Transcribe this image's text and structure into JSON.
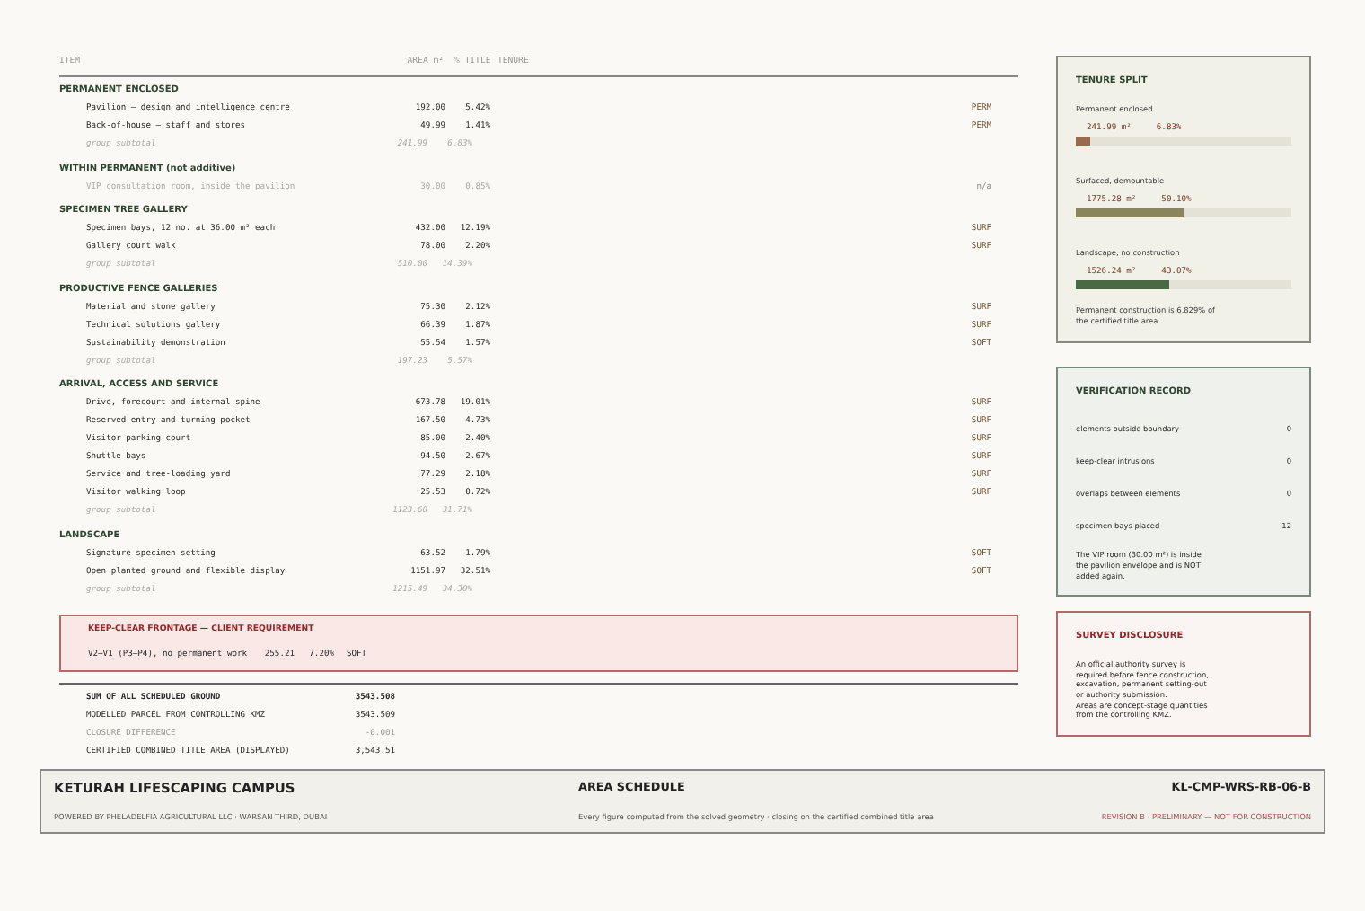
{
  "table": {
    "columns": [
      "ITEM",
      "AREA m²",
      "% TITLE",
      "TENURE"
    ],
    "groups": [
      {
        "title": "PERMANENT ENCLOSED",
        "kind": "additive",
        "items": [
          {
            "item": "Pavilion – design and intelligence centre",
            "area": "192.00",
            "pct": "5.42%",
            "tenure": "PERM"
          },
          {
            "item": "Back-of-house – staff and stores",
            "area": "49.99",
            "pct": "1.41%",
            "tenure": "PERM"
          }
        ],
        "subtotal": {
          "label": "group subtotal",
          "area": "241.99",
          "pct": "6.83%"
        }
      },
      {
        "title": "WITHIN PERMANENT (not additive)",
        "kind": "nonadditive",
        "items": [
          {
            "item": "VIP consultation room, inside the pavilion",
            "area": "30.00",
            "pct": "0.85%",
            "tenure": "n/a"
          }
        ]
      },
      {
        "title": "SPECIMEN TREE GALLERY",
        "kind": "additive",
        "items": [
          {
            "item": "Specimen bays, 12 no. at 36.00 m² each",
            "area": "432.00",
            "pct": "12.19%",
            "tenure": "SURF"
          },
          {
            "item": "Gallery court walk",
            "area": "78.00",
            "pct": "2.20%",
            "tenure": "SURF"
          }
        ],
        "subtotal": {
          "label": "group subtotal",
          "area": "510.00",
          "pct": "14.39%"
        }
      },
      {
        "title": "PRODUCTIVE FENCE GALLERIES",
        "kind": "additive",
        "items": [
          {
            "item": "Material and stone gallery",
            "area": "75.30",
            "pct": "2.12%",
            "tenure": "SURF"
          },
          {
            "item": "Technical solutions gallery",
            "area": "66.39",
            "pct": "1.87%",
            "tenure": "SURF"
          },
          {
            "item": "Sustainability demonstration",
            "area": "55.54",
            "pct": "1.57%",
            "tenure": "SOFT"
          }
        ],
        "subtotal": {
          "label": "group subtotal",
          "area": "197.23",
          "pct": "5.57%"
        }
      },
      {
        "title": "ARRIVAL, ACCESS AND SERVICE",
        "kind": "additive",
        "items": [
          {
            "item": "Drive, forecourt and internal spine",
            "area": "673.78",
            "pct": "19.01%",
            "tenure": "SURF"
          },
          {
            "item": "Reserved entry and turning pocket",
            "area": "167.50",
            "pct": "4.73%",
            "tenure": "SURF"
          },
          {
            "item": "Visitor parking court",
            "area": "85.00",
            "pct": "2.40%",
            "tenure": "SURF"
          },
          {
            "item": "Shuttle bays",
            "area": "94.50",
            "pct": "2.67%",
            "tenure": "SURF"
          },
          {
            "item": "Service and tree-loading yard",
            "area": "77.29",
            "pct": "2.18%",
            "tenure": "SURF"
          },
          {
            "item": "Visitor walking loop",
            "area": "25.53",
            "pct": "0.72%",
            "tenure": "SURF"
          }
        ],
        "subtotal": {
          "label": "group subtotal",
          "area": "1123.60",
          "pct": "31.71%"
        }
      },
      {
        "title": "LANDSCAPE",
        "kind": "additive",
        "items": [
          {
            "item": "Signature specimen setting",
            "area": "63.52",
            "pct": "1.79%",
            "tenure": "SOFT"
          },
          {
            "item": "Open planted ground and flexible display",
            "area": "1151.97",
            "pct": "32.51%",
            "tenure": "SOFT"
          }
        ],
        "subtotal": {
          "label": "group subtotal",
          "area": "1215.49",
          "pct": "34.30%"
        }
      }
    ]
  },
  "keep_clear": {
    "title": "KEEP-CLEAR FRONTAGE — CLIENT REQUIREMENT",
    "rows": [
      {
        "item": "V2–V1 (P3–P4), no permanent work",
        "area": "255.21",
        "pct": "7.20%",
        "tenure": "SOFT"
      }
    ]
  },
  "totals": [
    {
      "label": "SUM OF ALL SCHEDULED GROUND",
      "value": "3543.508",
      "kind": "bold"
    },
    {
      "label": "MODELLED PARCEL FROM CONTROLLING KMZ",
      "value": "3543.509",
      "kind": "plain"
    },
    {
      "label": "CLOSURE DIFFERENCE",
      "value": "-0.001",
      "kind": "muted"
    },
    {
      "label": "CERTIFIED COMBINED TITLE AREA (DISPLAYED)",
      "value": "3,543.51",
      "kind": "plain"
    }
  ],
  "sidebar": {
    "tenure_split": {
      "title": "TENURE SPLIT",
      "entries": [
        {
          "label": "Permanent enclosed",
          "area": "241.99 m²",
          "pct": "6.83%",
          "level": 0.0683,
          "color": "#9a6a50"
        },
        {
          "label": "Surfaced, demountable",
          "area": "1775.28 m²",
          "pct": "50.10%",
          "level": 0.501,
          "color": "#8a855a"
        },
        {
          "label": "Landscape, no construction",
          "area": "1526.24 m²",
          "pct": "43.07%",
          "level": 0.4307,
          "color": "#4a6a45"
        }
      ],
      "note": "Permanent construction is 6.829% of the certified title area."
    },
    "verification": {
      "title": "VERIFICATION RECORD",
      "checks": [
        {
          "label": "elements outside boundary",
          "value": "0"
        },
        {
          "label": "keep-clear intrusions",
          "value": "0"
        },
        {
          "label": "overlaps between elements",
          "value": "0"
        },
        {
          "label": "specimen bays placed",
          "value": "12"
        }
      ],
      "note": "The VIP room (30.00 m²) is inside the pavilion envelope and is NOT added again."
    },
    "disclosure": {
      "title": "SURVEY DISCLOSURE",
      "text": "An official authority survey is required before fence construction, excavation, permanent setting-out or authority submission.\nAreas are concept-stage quantities from the controlling KMZ."
    }
  },
  "footer": {
    "project": "KETURAH LIFESCAPING CAMPUS",
    "credit": "POWERED BY PHELADELFIA AGRICULTURAL LLC · WARSAN THIRD, DUBAI",
    "sheet_title": "AREA SCHEDULE",
    "sheet_note": "Every figure computed from the solved geometry · closing on the certified combined title area",
    "code": "KL-CMP-WRS-RB-06-B",
    "revision": "REVISION B · PRELIMINARY — NOT FOR CONSTRUCTION"
  }
}
